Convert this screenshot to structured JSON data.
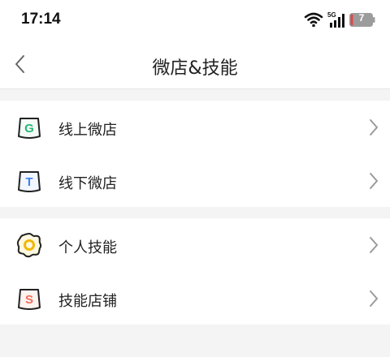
{
  "status_bar": {
    "time": "17:14",
    "network_label": "5G",
    "battery_level": "7",
    "icons": [
      "wifi-icon",
      "signal-icon",
      "battery-icon"
    ]
  },
  "header": {
    "title": "微店&技能",
    "back_icon": "chevron-left-icon"
  },
  "groups": [
    {
      "items": [
        {
          "label": "线上微店",
          "icon": "online-shop-icon",
          "icon_letter": "G",
          "icon_color": "#2bb673"
        },
        {
          "label": "线下微店",
          "icon": "offline-shop-icon",
          "icon_letter": "T",
          "icon_color": "#3b82f6"
        }
      ]
    },
    {
      "items": [
        {
          "label": "个人技能",
          "icon": "personal-skill-icon",
          "icon_color": "#f2b705"
        },
        {
          "label": "技能店铺",
          "icon": "skill-shop-icon",
          "icon_letter": "S",
          "icon_color": "#f26d5b"
        }
      ]
    }
  ],
  "colors": {
    "background": "#f4f4f4",
    "surface": "#ffffff",
    "text": "#222222",
    "chevron": "#9a9a9a",
    "battery_low": "#e04848"
  }
}
